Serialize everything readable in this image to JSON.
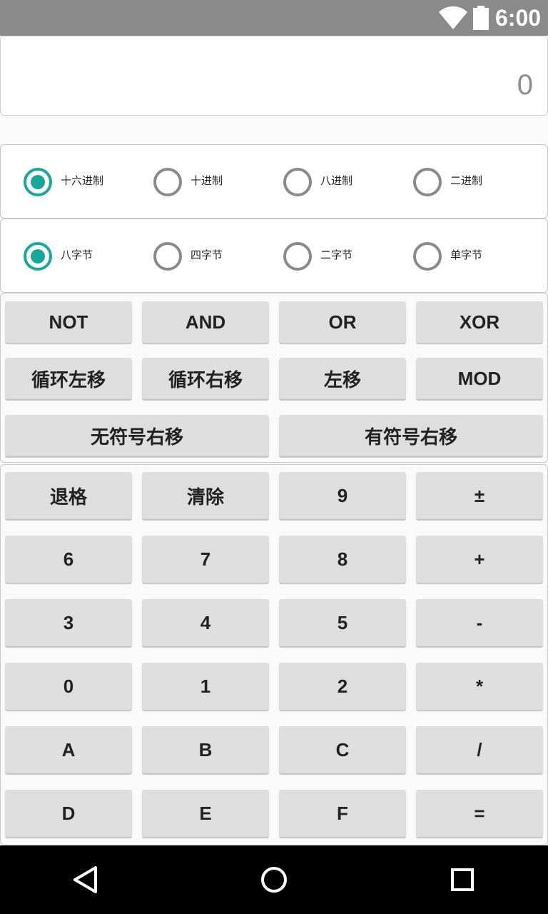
{
  "status_bar": {
    "time": "6:00",
    "icons": [
      "wifi-icon",
      "battery-icon"
    ]
  },
  "display": {
    "value": "0"
  },
  "base_options": [
    {
      "label": "十六进制",
      "checked": true
    },
    {
      "label": "十进制",
      "checked": false
    },
    {
      "label": "八进制",
      "checked": false
    },
    {
      "label": "二进制",
      "checked": false
    }
  ],
  "size_options": [
    {
      "label": "八字节",
      "checked": true
    },
    {
      "label": "四字节",
      "checked": false
    },
    {
      "label": "二字节",
      "checked": false
    },
    {
      "label": "单字节",
      "checked": false
    }
  ],
  "bit_ops": {
    "not": "NOT",
    "and": "AND",
    "or": "OR",
    "xor": "XOR",
    "rotate_left": "循环左移",
    "rotate_right": "循环右移",
    "shift_left": "左移",
    "mod": "MOD",
    "unsigned_shift_right": "无符号右移",
    "signed_shift_right": "有符号右移"
  },
  "keypad": {
    "backspace": "退格",
    "clear": "清除",
    "k9": "9",
    "plus_minus": "±",
    "k6": "6",
    "k7": "7",
    "k8": "8",
    "plus": "+",
    "k3": "3",
    "k4": "4",
    "k5": "5",
    "minus": "-",
    "k0": "0",
    "k1": "1",
    "k2": "2",
    "multiply": "*",
    "kA": "A",
    "kB": "B",
    "kC": "C",
    "divide": "/",
    "kD": "D",
    "kE": "E",
    "kF": "F",
    "equals": "="
  },
  "nav_bar": {
    "icons": [
      "back-icon",
      "home-icon",
      "recents-icon"
    ]
  },
  "colors": {
    "accent": "#19a79a",
    "status_bar": "#8a8a8a",
    "button": "#dedede",
    "nav_bar": "#000000"
  }
}
